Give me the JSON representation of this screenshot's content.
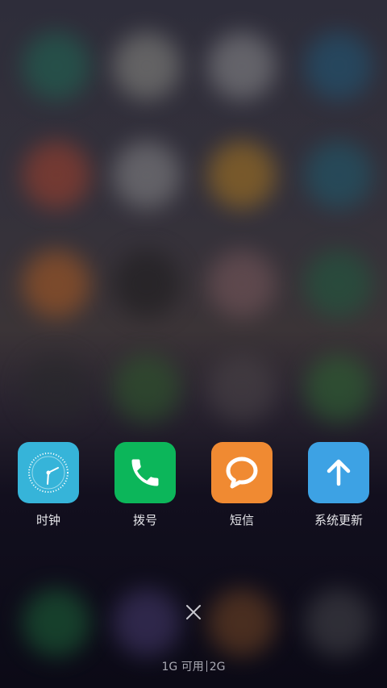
{
  "recent_apps": [
    {
      "label": "时钟",
      "icon": "clock-icon",
      "color": "#36b4d9"
    },
    {
      "label": "拨号",
      "icon": "phone-icon",
      "color": "#0cb65a"
    },
    {
      "label": "短信",
      "icon": "message-icon",
      "color": "#f08a32"
    },
    {
      "label": "系统更新",
      "icon": "arrow-up-icon",
      "color": "#3da2e4"
    }
  ],
  "memory": {
    "available": "1G 可用",
    "total": "2G"
  },
  "close": {
    "icon": "close-icon"
  }
}
